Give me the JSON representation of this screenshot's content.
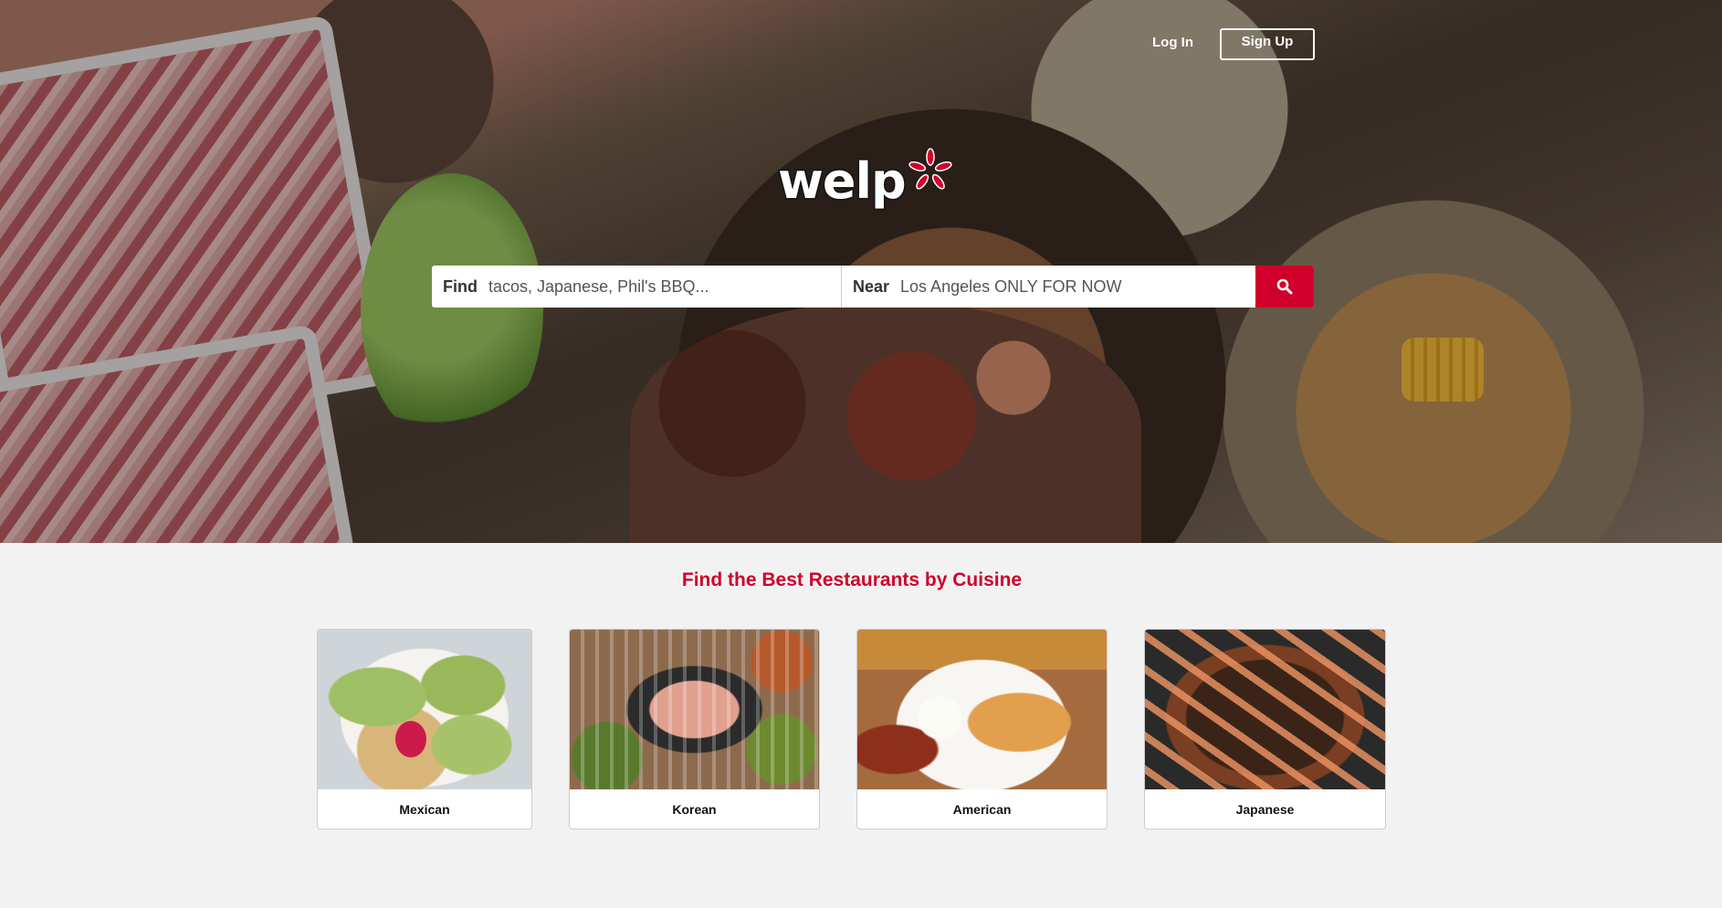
{
  "nav": {
    "login_label": "Log In",
    "signup_label": "Sign Up"
  },
  "brand": {
    "logo_text": "welp",
    "accent_color": "#d1002b"
  },
  "search": {
    "find_label": "Find",
    "find_placeholder": "tacos, Japanese, Phil's BBQ...",
    "near_label": "Near",
    "near_placeholder": "Los Angeles ONLY FOR NOW",
    "button_icon": "search-icon"
  },
  "cuisines": {
    "title": "Find the Best Restaurants by Cuisine",
    "items": [
      {
        "label": "Mexican"
      },
      {
        "label": "Korean"
      },
      {
        "label": "American"
      },
      {
        "label": "Japanese"
      }
    ]
  }
}
